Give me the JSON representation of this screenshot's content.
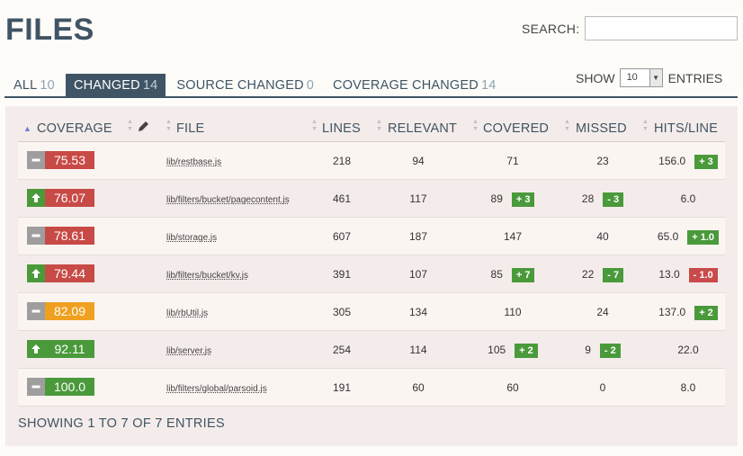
{
  "page": {
    "title": "FILES",
    "search_label": "SEARCH:",
    "search_value": "",
    "show_label": "SHOW",
    "entries_label": "ENTRIES",
    "show_value": "10",
    "footer": "SHOWING 1 TO 7 OF 7 ENTRIES"
  },
  "tabs": [
    {
      "label": "ALL",
      "count": "10",
      "active": false
    },
    {
      "label": "CHANGED",
      "count": "14",
      "active": true
    },
    {
      "label": "SOURCE CHANGED",
      "count": "0",
      "active": false
    },
    {
      "label": "COVERAGE CHANGED",
      "count": "14",
      "active": false
    }
  ],
  "columns": {
    "coverage": "COVERAGE",
    "file": "FILE",
    "lines": "LINES",
    "relevant": "RELEVANT",
    "covered": "COVERED",
    "missed": "MISSED",
    "hits_line": "HITS/LINE"
  },
  "colors": {
    "red": "#c84a46",
    "green": "#4a9a3b",
    "orange": "#f0a020",
    "neutral_icon": "#9e9e9e",
    "up_icon": "#4a9a3b"
  },
  "rows": [
    {
      "trend": "flat",
      "coverage": "75.53",
      "level": "red",
      "file": "lib/restbase.js",
      "lines": "218",
      "relevant": "94",
      "covered": "71",
      "covered_delta": "",
      "missed": "23",
      "missed_delta": "",
      "hits": "156.0",
      "hits_delta": "+ 3",
      "hits_delta_sign": "pos"
    },
    {
      "trend": "up",
      "coverage": "76.07",
      "level": "red",
      "file": "lib/filters/bucket/pagecontent.js",
      "lines": "461",
      "relevant": "117",
      "covered": "89",
      "covered_delta": "+ 3",
      "missed": "28",
      "missed_delta": "- 3",
      "hits": "6.0",
      "hits_delta": "",
      "hits_delta_sign": ""
    },
    {
      "trend": "flat",
      "coverage": "78.61",
      "level": "red",
      "file": "lib/storage.js",
      "lines": "607",
      "relevant": "187",
      "covered": "147",
      "covered_delta": "",
      "missed": "40",
      "missed_delta": "",
      "hits": "65.0",
      "hits_delta": "+ 1.0",
      "hits_delta_sign": "pos"
    },
    {
      "trend": "up",
      "coverage": "79.44",
      "level": "red",
      "file": "lib/filters/bucket/kv.js",
      "lines": "391",
      "relevant": "107",
      "covered": "85",
      "covered_delta": "+ 7",
      "missed": "22",
      "missed_delta": "- 7",
      "hits": "13.0",
      "hits_delta": "- 1.0",
      "hits_delta_sign": "neg"
    },
    {
      "trend": "flat",
      "coverage": "82.09",
      "level": "orange",
      "file": "lib/rbUtil.js",
      "lines": "305",
      "relevant": "134",
      "covered": "110",
      "covered_delta": "",
      "missed": "24",
      "missed_delta": "",
      "hits": "137.0",
      "hits_delta": "+ 2",
      "hits_delta_sign": "pos"
    },
    {
      "trend": "up",
      "coverage": "92.11",
      "level": "green",
      "file": "lib/server.js",
      "lines": "254",
      "relevant": "114",
      "covered": "105",
      "covered_delta": "+ 2",
      "missed": "9",
      "missed_delta": "- 2",
      "hits": "22.0",
      "hits_delta": "",
      "hits_delta_sign": ""
    },
    {
      "trend": "flat",
      "coverage": "100.0",
      "level": "green",
      "file": "lib/filters/global/parsoid.js",
      "lines": "191",
      "relevant": "60",
      "covered": "60",
      "covered_delta": "",
      "missed": "0",
      "missed_delta": "",
      "hits": "8.0",
      "hits_delta": "",
      "hits_delta_sign": ""
    }
  ]
}
